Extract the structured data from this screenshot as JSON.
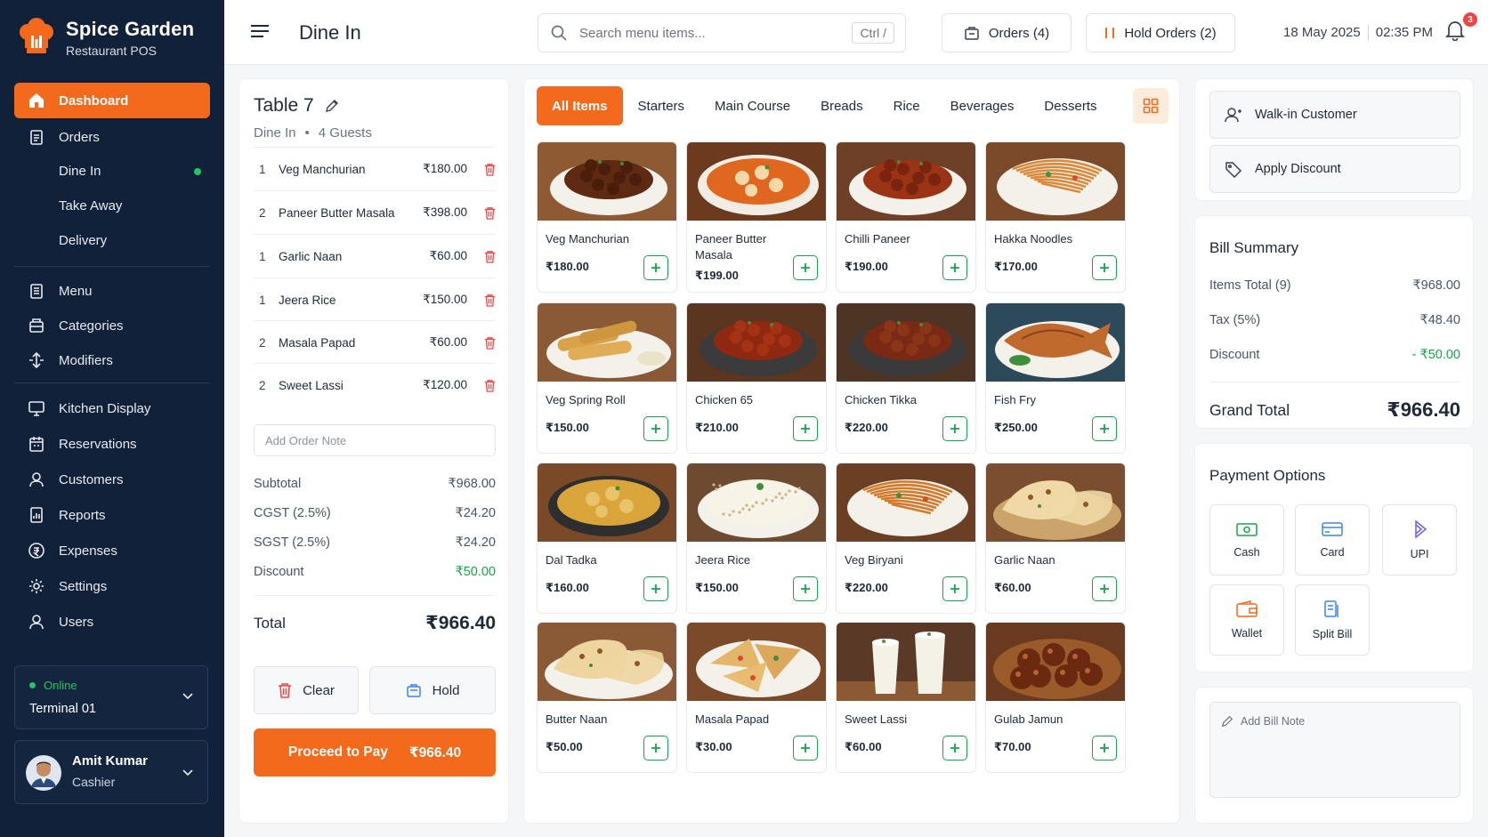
{
  "app": {
    "name": "Spice Garden",
    "subtitle": "Restaurant POS"
  },
  "sidebar": {
    "dashboard": "Dashboard",
    "orders": "Orders",
    "sub": [
      "Dine In",
      "Take Away",
      "Delivery"
    ],
    "menu": "Menu",
    "categories": "Categories",
    "modifiers": "Modifiers",
    "kitchen": "Kitchen Display",
    "reservations": "Reservations",
    "customers": "Customers",
    "reports": "Reports",
    "expenses": "Expenses",
    "settings": "Settings",
    "users": "Users",
    "status": "Online",
    "terminal": "Terminal 01",
    "user_name": "Amit Kumar",
    "user_role": "Cashier"
  },
  "header": {
    "title": "Dine In",
    "search_placeholder": "Search menu items...",
    "shortcut": "Ctrl /",
    "orders_btn": "Orders (4)",
    "hold_btn": "Hold Orders (2)",
    "date": "18 May 2025",
    "time": "02:35 PM",
    "notif_count": "3"
  },
  "order": {
    "table": "Table 7",
    "type": "Dine In",
    "guests": "4 Guests",
    "items": [
      {
        "qty": "1",
        "name": "Veg Manchurian",
        "price": "₹180.00"
      },
      {
        "qty": "2",
        "name": "Paneer Butter Masala",
        "price": "₹398.00"
      },
      {
        "qty": "1",
        "name": "Garlic Naan",
        "price": "₹60.00"
      },
      {
        "qty": "1",
        "name": "Jeera Rice",
        "price": "₹150.00"
      },
      {
        "qty": "2",
        "name": "Masala Papad",
        "price": "₹60.00"
      },
      {
        "qty": "2",
        "name": "Sweet Lassi",
        "price": "₹120.00"
      }
    ],
    "note_placeholder": "Add Order Note",
    "subtotal_label": "Subtotal",
    "subtotal": "₹968.00",
    "cgst_label": "CGST (2.5%)",
    "cgst": "₹24.20",
    "sgst_label": "SGST (2.5%)",
    "sgst": "₹24.20",
    "discount_label": "Discount",
    "discount": "₹50.00",
    "total_label": "Total",
    "total": "₹966.40",
    "clear": "Clear",
    "hold": "Hold",
    "proceed": "Proceed to Pay",
    "proceed_amount": "₹966.40"
  },
  "menu": {
    "tabs": [
      "All Items",
      "Starters",
      "Main Course",
      "Breads",
      "Rice",
      "Beverages",
      "Desserts"
    ],
    "items": [
      {
        "name": "Veg Manchurian",
        "price": "₹180.00"
      },
      {
        "name": "Paneer Butter Masala",
        "price": "₹199.00"
      },
      {
        "name": "Chilli Paneer",
        "price": "₹190.00"
      },
      {
        "name": "Hakka Noodles",
        "price": "₹170.00"
      },
      {
        "name": "Veg Spring Roll",
        "price": "₹150.00"
      },
      {
        "name": "Chicken 65",
        "price": "₹210.00"
      },
      {
        "name": "Chicken Tikka",
        "price": "₹220.00"
      },
      {
        "name": "Fish Fry",
        "price": "₹250.00"
      },
      {
        "name": "Dal Tadka",
        "price": "₹160.00"
      },
      {
        "name": "Jeera Rice",
        "price": "₹150.00"
      },
      {
        "name": "Veg Biryani",
        "price": "₹220.00"
      },
      {
        "name": "Garlic Naan",
        "price": "₹60.00"
      },
      {
        "name": "Butter Naan",
        "price": "₹50.00"
      },
      {
        "name": "Masala Papad",
        "price": "₹30.00"
      },
      {
        "name": "Sweet Lassi",
        "price": "₹60.00"
      },
      {
        "name": "Gulab Jamun",
        "price": "₹70.00"
      }
    ]
  },
  "right": {
    "customer": "Walk-in Customer",
    "apply_discount": "Apply Discount",
    "bill_title": "Bill Summary",
    "items_total_label": "Items Total (9)",
    "items_total": "₹968.00",
    "tax_label": "Tax (5%)",
    "tax": "₹48.40",
    "discount_label": "Discount",
    "discount": "- ₹50.00",
    "grand_total_label": "Grand Total",
    "grand_total": "₹966.40",
    "payment_title": "Payment Options",
    "payments": [
      "Cash",
      "Card",
      "UPI",
      "Wallet",
      "Split Bill"
    ],
    "bill_note": "Add Bill Note"
  },
  "colors": {
    "accent": "#f36a1d",
    "sidebar": "#12213a",
    "success": "#16a34a",
    "danger": "#ef4444"
  }
}
